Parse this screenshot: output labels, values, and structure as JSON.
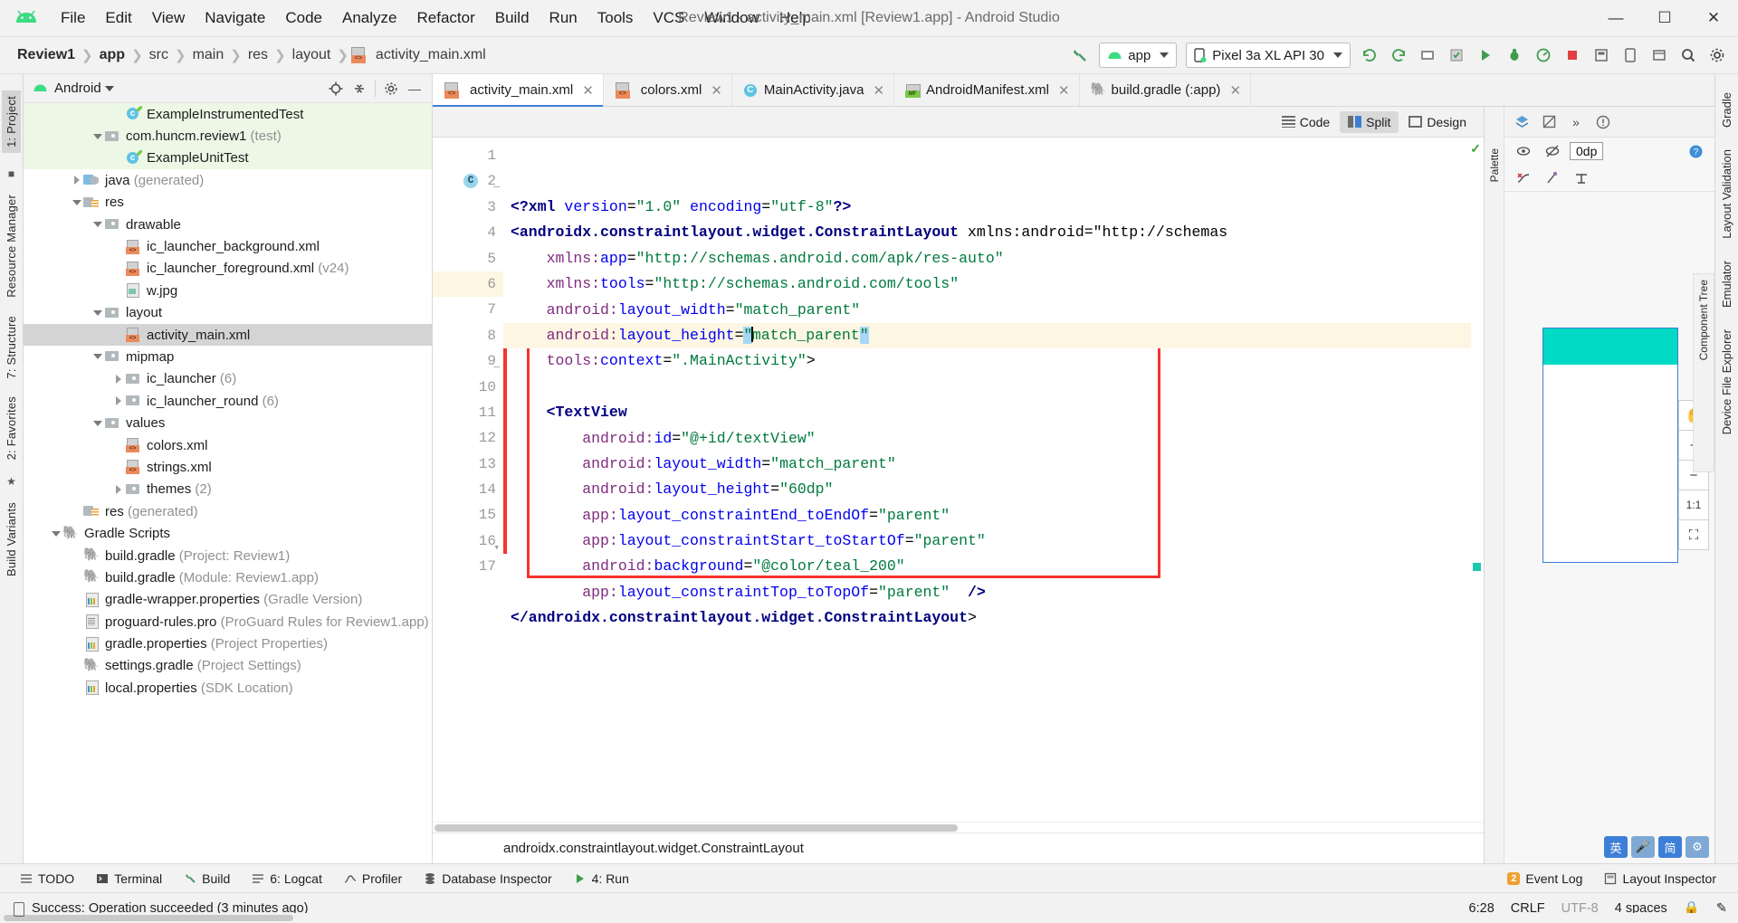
{
  "window": {
    "title": "Review1 - activity_main.xml [Review1.app] - Android Studio",
    "minimize": "—",
    "maximize": "☐",
    "close": "✕"
  },
  "menu": [
    {
      "label": "File"
    },
    {
      "label": "Edit"
    },
    {
      "label": "View"
    },
    {
      "label": "Navigate"
    },
    {
      "label": "Code"
    },
    {
      "label": "Analyze"
    },
    {
      "label": "Refactor"
    },
    {
      "label": "Build"
    },
    {
      "label": "Run"
    },
    {
      "label": "Tools"
    },
    {
      "label": "VCS"
    },
    {
      "label": "Window"
    },
    {
      "label": "Help"
    }
  ],
  "breadcrumbs": [
    "Review1",
    "app",
    "src",
    "main",
    "res",
    "layout",
    "activity_main.xml"
  ],
  "toolbar": {
    "build_hammer": "build-icon",
    "run_config": "app",
    "device": "Pixel 3a XL API 30",
    "buttons": [
      "sync-gradle-icon",
      "sync-project-icon",
      "avd-manager-icon",
      "sdk-manager-icon",
      "run-icon",
      "debug-icon",
      "profile-icon",
      "stop-icon",
      "layout-inspector-icon",
      "device-manager-icon",
      "device-file-explorer-icon",
      "search-icon",
      "settings-icon"
    ]
  },
  "left_rail": [
    {
      "label": "1: Project",
      "selected": true
    },
    {
      "label": "Resource Manager",
      "selected": false
    },
    {
      "label": "7: Structure",
      "selected": false
    },
    {
      "label": "2: Favorites",
      "selected": false
    },
    {
      "label": "Build Variants",
      "selected": false
    }
  ],
  "right_rail": [
    {
      "label": "Gradle"
    },
    {
      "label": "Layout Validation"
    },
    {
      "label": "Emulator"
    },
    {
      "label": "Device File Explorer"
    }
  ],
  "project_panel": {
    "title": "Android",
    "header_buttons": [
      "locate-icon",
      "collapse-all-icon",
      "settings-icon",
      "hide-icon"
    ],
    "tree": [
      {
        "indent": 4,
        "arrow": "none",
        "icon": "class",
        "label": "ExampleInstrumentedTest",
        "suffix": "",
        "style": "green"
      },
      {
        "indent": 3,
        "arrow": "down",
        "icon": "folder",
        "label": "com.huncm.review1",
        "suffix": " (test)",
        "style": "green"
      },
      {
        "indent": 4,
        "arrow": "none",
        "icon": "class",
        "label": "ExampleUnitTest",
        "suffix": "",
        "style": "green"
      },
      {
        "indent": 2,
        "arrow": "right",
        "icon": "java",
        "label": "java",
        "suffix": " (generated)",
        "style": ""
      },
      {
        "indent": 2,
        "arrow": "down",
        "icon": "res",
        "label": "res",
        "suffix": "",
        "style": ""
      },
      {
        "indent": 3,
        "arrow": "down",
        "icon": "folder",
        "label": "drawable",
        "suffix": "",
        "style": ""
      },
      {
        "indent": 4,
        "arrow": "none",
        "icon": "xml",
        "label": "ic_launcher_background.xml",
        "suffix": "",
        "style": ""
      },
      {
        "indent": 4,
        "arrow": "none",
        "icon": "xml",
        "label": "ic_launcher_foreground.xml",
        "suffix": " (v24)",
        "style": ""
      },
      {
        "indent": 4,
        "arrow": "none",
        "icon": "jpg",
        "label": "w.jpg",
        "suffix": "",
        "style": ""
      },
      {
        "indent": 3,
        "arrow": "down",
        "icon": "folder",
        "label": "layout",
        "suffix": "",
        "style": ""
      },
      {
        "indent": 4,
        "arrow": "none",
        "icon": "xml",
        "label": "activity_main.xml",
        "suffix": "",
        "style": "sel"
      },
      {
        "indent": 3,
        "arrow": "down",
        "icon": "folder",
        "label": "mipmap",
        "suffix": "",
        "style": ""
      },
      {
        "indent": 4,
        "arrow": "right",
        "icon": "folder",
        "label": "ic_launcher",
        "suffix": " (6)",
        "style": ""
      },
      {
        "indent": 4,
        "arrow": "right",
        "icon": "folder",
        "label": "ic_launcher_round",
        "suffix": " (6)",
        "style": ""
      },
      {
        "indent": 3,
        "arrow": "down",
        "icon": "folder",
        "label": "values",
        "suffix": "",
        "style": ""
      },
      {
        "indent": 4,
        "arrow": "none",
        "icon": "xml",
        "label": "colors.xml",
        "suffix": "",
        "style": ""
      },
      {
        "indent": 4,
        "arrow": "none",
        "icon": "xml",
        "label": "strings.xml",
        "suffix": "",
        "style": ""
      },
      {
        "indent": 4,
        "arrow": "right",
        "icon": "folder",
        "label": "themes",
        "suffix": " (2)",
        "style": ""
      },
      {
        "indent": 2,
        "arrow": "none",
        "icon": "res",
        "label": "res",
        "suffix": " (generated)",
        "style": ""
      },
      {
        "indent": 1,
        "arrow": "down",
        "icon": "gradle",
        "label": "Gradle Scripts",
        "suffix": "",
        "style": ""
      },
      {
        "indent": 2,
        "arrow": "none",
        "icon": "gradle",
        "label": "build.gradle",
        "suffix": " (Project: Review1)",
        "style": ""
      },
      {
        "indent": 2,
        "arrow": "none",
        "icon": "gradle",
        "label": "build.gradle",
        "suffix": " (Module: Review1.app)",
        "style": ""
      },
      {
        "indent": 2,
        "arrow": "none",
        "icon": "prop",
        "label": "gradle-wrapper.properties",
        "suffix": " (Gradle Version)",
        "style": ""
      },
      {
        "indent": 2,
        "arrow": "none",
        "icon": "plain",
        "label": "proguard-rules.pro",
        "suffix": " (ProGuard Rules for Review1.app)",
        "style": ""
      },
      {
        "indent": 2,
        "arrow": "none",
        "icon": "prop",
        "label": "gradle.properties",
        "suffix": " (Project Properties)",
        "style": ""
      },
      {
        "indent": 2,
        "arrow": "none",
        "icon": "gradle",
        "label": "settings.gradle",
        "suffix": " (Project Settings)",
        "style": ""
      },
      {
        "indent": 2,
        "arrow": "none",
        "icon": "prop",
        "label": "local.properties",
        "suffix": " (SDK Location)",
        "style": ""
      }
    ]
  },
  "editor_tabs": [
    {
      "label": "activity_main.xml",
      "icon": "xml-file-icon",
      "active": true
    },
    {
      "label": "colors.xml",
      "icon": "xml-file-icon",
      "active": false
    },
    {
      "label": "MainActivity.java",
      "icon": "java-class-icon",
      "active": false
    },
    {
      "label": "AndroidManifest.xml",
      "icon": "manifest-file-icon",
      "active": false
    },
    {
      "label": "build.gradle (:app)",
      "icon": "gradle-file-icon",
      "active": false
    }
  ],
  "view_modes": [
    {
      "label": "Code",
      "active": false
    },
    {
      "label": "Split",
      "active": true
    },
    {
      "label": "Design",
      "active": false
    }
  ],
  "code": {
    "lines": [
      {
        "n": 1,
        "text": "<?xml version=\"1.0\" encoding=\"utf-8\"?>"
      },
      {
        "n": 2,
        "text": "<androidx.constraintlayout.widget.ConstraintLayout xmlns:android=\"http://schemas"
      },
      {
        "n": 3,
        "text": "    xmlns:app=\"http://schemas.android.com/apk/res-auto\""
      },
      {
        "n": 4,
        "text": "    xmlns:tools=\"http://schemas.android.com/tools\""
      },
      {
        "n": 5,
        "text": "    android:layout_width=\"match_parent\""
      },
      {
        "n": 6,
        "text": "    android:layout_height=\"match_parent\""
      },
      {
        "n": 7,
        "text": "    tools:context=\".MainActivity\">"
      },
      {
        "n": 8,
        "text": ""
      },
      {
        "n": 9,
        "text": "    <TextView"
      },
      {
        "n": 10,
        "text": "        android:id=\"@+id/textView\""
      },
      {
        "n": 11,
        "text": "        android:layout_width=\"match_parent\""
      },
      {
        "n": 12,
        "text": "        android:layout_height=\"60dp\""
      },
      {
        "n": 13,
        "text": "        app:layout_constraintEnd_toEndOf=\"parent\""
      },
      {
        "n": 14,
        "text": "        app:layout_constraintStart_toStartOf=\"parent\""
      },
      {
        "n": 15,
        "text": "        android:background=\"@color/teal_200\""
      },
      {
        "n": 16,
        "text": "        app:layout_constraintTop_toTopOf=\"parent\"  />"
      },
      {
        "n": 17,
        "text": "</androidx.constraintlayout.widget.ConstraintLayout>"
      }
    ],
    "highlight_line": 6,
    "breakpoint_line": 2,
    "breakpoint_glyph": "C",
    "status_path": "androidx.constraintlayout.widget.ConstraintLayout"
  },
  "design": {
    "palette_label": "Palette",
    "component_tree_label": "Component Tree",
    "zero_dp_label": "0dp",
    "tool_buttons": [
      "pan-icon",
      "zoom-in-icon",
      "zoom-out-icon",
      "zoom-actual-icon",
      "zoom-fit-icon"
    ],
    "teal_color": "#03dac5"
  },
  "bottom_tools": [
    {
      "label": "TODO",
      "icon": "todo-icon"
    },
    {
      "label": "Terminal",
      "icon": "terminal-icon"
    },
    {
      "label": "Build",
      "icon": "build-icon"
    },
    {
      "label": "6: Logcat",
      "icon": "logcat-icon"
    },
    {
      "label": "Profiler",
      "icon": "profiler-icon"
    },
    {
      "label": "Database Inspector",
      "icon": "database-icon"
    },
    {
      "label": "4: Run",
      "icon": "run-icon"
    }
  ],
  "bottom_tools_right": [
    {
      "label": "Event Log",
      "icon": "event-log-icon",
      "badge": "2"
    },
    {
      "label": "Layout Inspector",
      "icon": "layout-inspector-icon",
      "badge": ""
    }
  ],
  "statusbar": {
    "message": "Success: Operation succeeded (3 minutes ago)",
    "caret": "6:28",
    "line_sep": "CRLF",
    "encoding": "UTF-8",
    "indent": "4 spaces",
    "lock": "lock-icon",
    "inspector": "inspection-icon"
  }
}
